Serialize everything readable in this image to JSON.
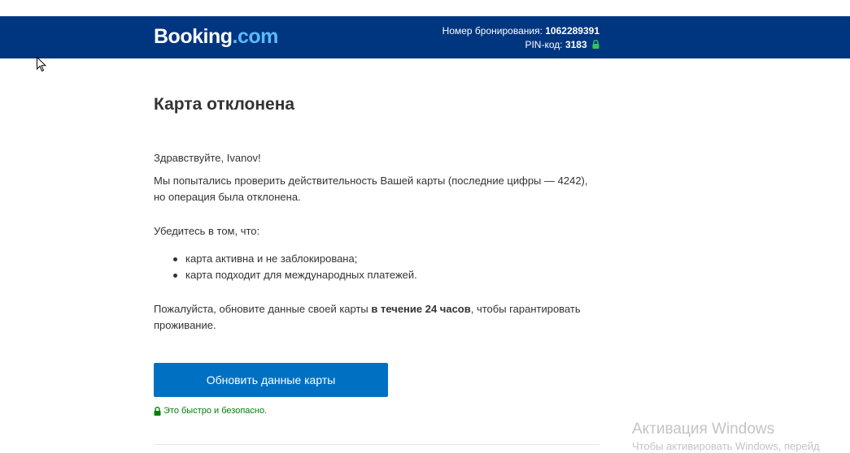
{
  "header": {
    "logo_part1": "Booking",
    "logo_part2": ".com",
    "booking_number_label": "Номер бронирования:",
    "booking_number": "1062289391",
    "pin_label": "PIN-код:",
    "pin": "3183",
    "background_color": "#003580"
  },
  "main": {
    "title": "Карта отклонена",
    "greeting": "Здравствуйте, Ivanov!",
    "message": "Мы попытались проверить действительность Вашей карты (последние цифры — 4242), но операция была отклонена.",
    "check_intro": "Убедитесь в том, что:",
    "checklist": [
      "карта активна и не заблокирована;",
      "карта подходит для международных платежей."
    ],
    "update_prefix": "Пожалуйста, обновите данные своей карты ",
    "update_bold": "в течение 24 часов",
    "update_suffix": ", чтобы гарантировать проживание.",
    "button_label": "Обновить данные карты",
    "button_color": "#0071c2",
    "secure_note": "Это быстро и безопасно.",
    "secure_color": "#008009"
  },
  "watermark": {
    "line1": "Активация Windows",
    "line2": "Чтобы активировать Windows, перейд"
  }
}
